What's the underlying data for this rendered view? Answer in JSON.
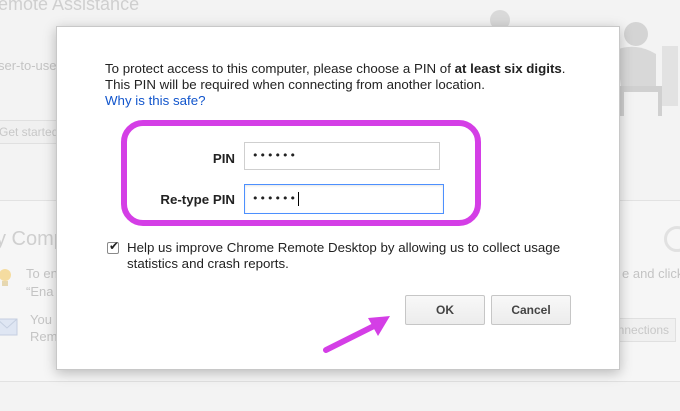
{
  "background": {
    "app_title": "emote Assistance",
    "section_text": "ser-to-use",
    "get_started": "Get started",
    "my_computers": "y Comp",
    "tip_line1": "To en",
    "tip_line2": "“Ena",
    "mail_line1": "You",
    "mail_line2": "Rem",
    "right_text": "e and click",
    "connections": "onnections"
  },
  "dialog": {
    "intro_prefix": "To protect access to this computer, please choose a PIN of ",
    "intro_bold": "at least six digits",
    "intro_suffix": ". This PIN will be required when connecting from another location.",
    "why_link": "Why is this safe?",
    "pin_label": "PIN",
    "pin_value": "••••••",
    "retype_label": "Re-type PIN",
    "retype_value": "••••••",
    "checkbox_checked": true,
    "checkbox_label": "Help us improve Chrome Remote Desktop by allowing us to collect usage statistics and crash reports.",
    "ok_label": "OK",
    "cancel_label": "Cancel"
  },
  "colors": {
    "highlight": "#d43ee6",
    "arrow": "#d43ee6",
    "link": "#1155cc",
    "focus_border": "#4d90fe"
  }
}
